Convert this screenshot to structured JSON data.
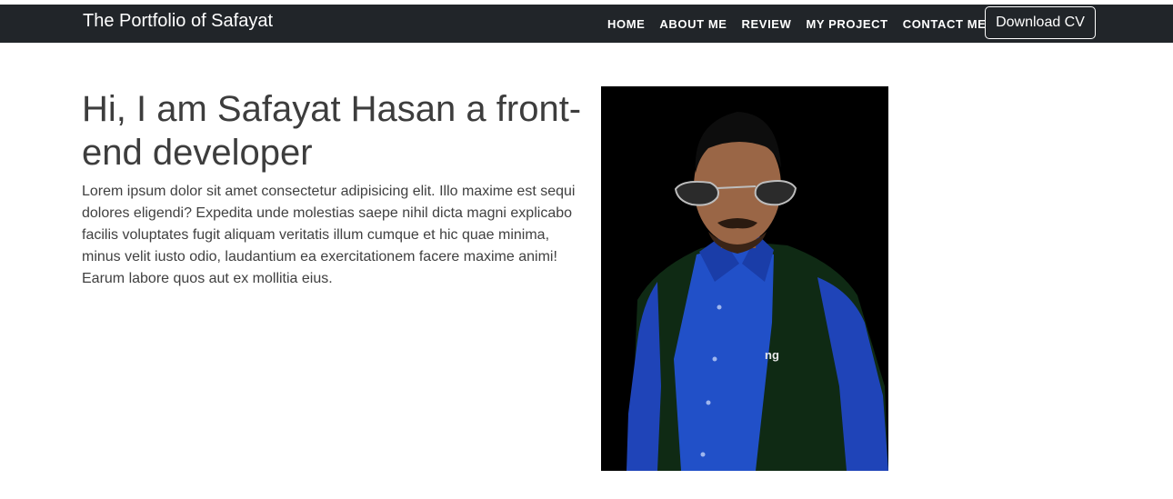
{
  "navbar": {
    "brand": "The Portfolio of Safayat",
    "links": [
      "HOME",
      "ABOUT ME",
      "REVIEW",
      "MY PROJECT",
      "CONTACT ME"
    ],
    "cta_label": "Download CV"
  },
  "hero": {
    "heading": "Hi, I am Safayat Hasan a front-end developer",
    "paragraph": "Lorem ipsum dolor sit amet consectetur adipisicing elit. Illo maxime est sequi dolores eligendi? Expedita unde molestias saepe nihil dicta magni explicabo facilis voluptates fugit aliquam veritatis illum cumque et hic quae minima, minus velit iusto odio, laudantium ea exercitationem facere maxime animi! Earum labore quos aut ex mollitia eius.",
    "photo_alt": "Portrait photo"
  },
  "colors": {
    "navbar_bg": "#212529",
    "text": "#3d3d3d",
    "shirt": "#1f44b8",
    "vest": "#0f2a14"
  }
}
